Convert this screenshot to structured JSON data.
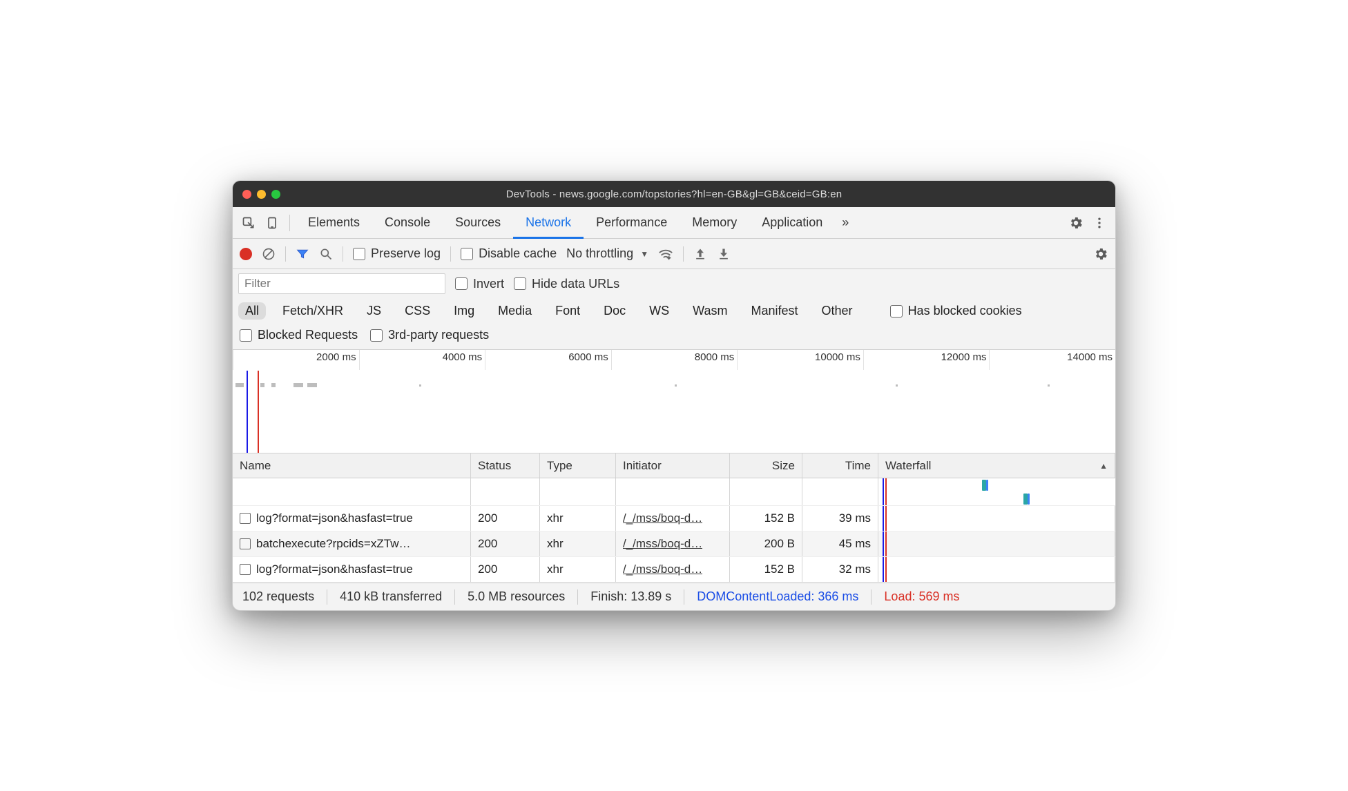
{
  "window": {
    "title": "DevTools - news.google.com/topstories?hl=en-GB&gl=GB&ceid=GB:en"
  },
  "tabs": {
    "items": [
      "Elements",
      "Console",
      "Sources",
      "Network",
      "Performance",
      "Memory",
      "Application"
    ],
    "active": "Network",
    "more_glyph": "»"
  },
  "toolbar": {
    "preserve_log": "Preserve log",
    "disable_cache": "Disable cache",
    "throttling": "No throttling"
  },
  "filter": {
    "placeholder": "Filter",
    "invert": "Invert",
    "hide_data_urls": "Hide data URLs"
  },
  "types": {
    "items": [
      "All",
      "Fetch/XHR",
      "JS",
      "CSS",
      "Img",
      "Media",
      "Font",
      "Doc",
      "WS",
      "Wasm",
      "Manifest",
      "Other"
    ],
    "active": "All",
    "has_blocked_cookies": "Has blocked cookies"
  },
  "block": {
    "blocked_requests": "Blocked Requests",
    "third_party": "3rd-party requests"
  },
  "timeline": {
    "ticks": [
      "2000 ms",
      "4000 ms",
      "6000 ms",
      "8000 ms",
      "10000 ms",
      "12000 ms",
      "14000 ms"
    ]
  },
  "table": {
    "headers": {
      "name": "Name",
      "status": "Status",
      "type": "Type",
      "initiator": "Initiator",
      "size": "Size",
      "time": "Time",
      "waterfall": "Waterfall"
    },
    "rows": [
      {
        "name": "log?format=json&hasfast=true",
        "status": "200",
        "type": "xhr",
        "initiator": "/_/mss/boq-d…",
        "size": "152 B",
        "time": "39 ms"
      },
      {
        "name": "batchexecute?rpcids=xZTw…",
        "status": "200",
        "type": "xhr",
        "initiator": "/_/mss/boq-d…",
        "size": "200 B",
        "time": "45 ms"
      },
      {
        "name": "log?format=json&hasfast=true",
        "status": "200",
        "type": "xhr",
        "initiator": "/_/mss/boq-d…",
        "size": "152 B",
        "time": "32 ms"
      }
    ]
  },
  "status": {
    "requests": "102 requests",
    "transferred": "410 kB transferred",
    "resources": "5.0 MB resources",
    "finish": "Finish: 13.89 s",
    "dcl": "DOMContentLoaded: 366 ms",
    "load": "Load: 569 ms"
  }
}
